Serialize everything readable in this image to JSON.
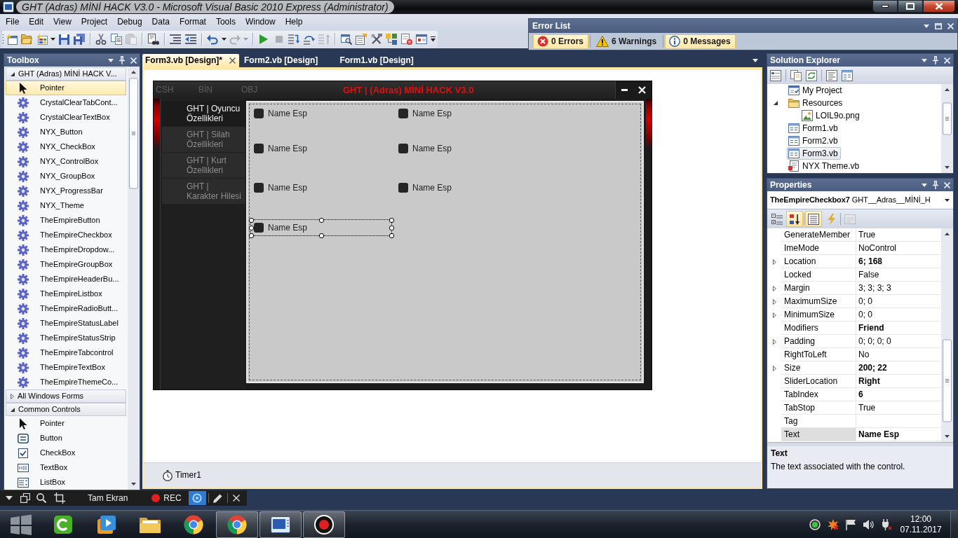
{
  "window": {
    "title": "GHT (Adras) MİNİ HACK V3.0 - Microsoft Visual Basic 2010 Express (Administrator)"
  },
  "menu": [
    "File",
    "Edit",
    "View",
    "Project",
    "Debug",
    "Data",
    "Format",
    "Tools",
    "Window",
    "Help"
  ],
  "toolbar": [
    {
      "buttons": [
        {
          "kind": "new-project",
          "disabled": false
        },
        {
          "kind": "open",
          "disabled": false
        },
        {
          "kind": "add-item",
          "disabled": false
        },
        {
          "kind": "dropdown",
          "disabled": false
        },
        {
          "kind": "save",
          "disabled": false
        },
        {
          "kind": "save-all",
          "disabled": false
        }
      ]
    },
    {
      "buttons": [
        {
          "kind": "cut",
          "disabled": false
        },
        {
          "kind": "copy",
          "disabled": false
        },
        {
          "kind": "paste",
          "disabled": true
        }
      ]
    },
    {
      "buttons": [
        {
          "kind": "find",
          "disabled": false
        }
      ]
    },
    {
      "buttons": [
        {
          "kind": "comment",
          "disabled": false
        },
        {
          "kind": "uncomment",
          "disabled": false
        }
      ]
    },
    {
      "buttons": [
        {
          "kind": "undo",
          "disabled": false
        },
        {
          "kind": "dropdown",
          "disabled": false
        },
        {
          "kind": "redo",
          "disabled": true
        },
        {
          "kind": "dropdown",
          "disabled": true
        }
      ]
    },
    {
      "buttons": [
        {
          "kind": "start",
          "disabled": false
        },
        {
          "kind": "stop",
          "disabled": true
        },
        {
          "kind": "step-into",
          "disabled": false
        },
        {
          "kind": "step-over",
          "disabled": false
        },
        {
          "kind": "step-out",
          "disabled": true
        }
      ]
    },
    {
      "buttons": [
        {
          "kind": "solution-explorer",
          "disabled": false
        },
        {
          "kind": "properties",
          "disabled": false
        },
        {
          "kind": "toolbox",
          "disabled": false
        },
        {
          "kind": "object-browser",
          "disabled": false
        },
        {
          "kind": "error-list",
          "disabled": false
        },
        {
          "kind": "immediate",
          "disabled": false
        },
        {
          "kind": "overflow",
          "disabled": false
        }
      ]
    }
  ],
  "error_list": {
    "title": "Error List",
    "filters": [
      {
        "kind": "error",
        "label": "0 Errors",
        "selected": true
      },
      {
        "kind": "warning",
        "label": "6 Warnings",
        "selected": false
      },
      {
        "kind": "info",
        "label": "0 Messages",
        "selected": true
      }
    ]
  },
  "toolbox": {
    "title": "Toolbox",
    "groups": [
      {
        "label": "GHT (Adras) MİNİ HACK V...",
        "expanded": true,
        "children": [
          {
            "label": "Pointer",
            "kind": "pointer",
            "selected": true
          },
          {
            "label": "CrystalClearTabCont...",
            "kind": "component",
            "selected": false
          },
          {
            "label": "CrystalClearTextBox",
            "kind": "component",
            "selected": false
          },
          {
            "label": "NYX_Button",
            "kind": "component",
            "selected": false
          },
          {
            "label": "NYX_CheckBox",
            "kind": "component",
            "selected": false
          },
          {
            "label": "NYX_ControlBox",
            "kind": "component",
            "selected": false
          },
          {
            "label": "NYX_GroupBox",
            "kind": "component",
            "selected": false
          },
          {
            "label": "NYX_ProgressBar",
            "kind": "component",
            "selected": false
          },
          {
            "label": "NYX_Theme",
            "kind": "component",
            "selected": false
          },
          {
            "label": "TheEmpireButton",
            "kind": "component",
            "selected": false
          },
          {
            "label": "TheEmpireCheckbox",
            "kind": "component",
            "selected": false
          },
          {
            "label": "TheEmpireDropdow...",
            "kind": "component",
            "selected": false
          },
          {
            "label": "TheEmpireGroupBox",
            "kind": "component",
            "selected": false
          },
          {
            "label": "TheEmpireHeaderBu...",
            "kind": "component",
            "selected": false
          },
          {
            "label": "TheEmpireListbox",
            "kind": "component",
            "selected": false
          },
          {
            "label": "TheEmpireRadioButt...",
            "kind": "component",
            "selected": false
          },
          {
            "label": "TheEmpireStatusLabel",
            "kind": "component",
            "selected": false
          },
          {
            "label": "TheEmpireStatusStrip",
            "kind": "component",
            "selected": false
          },
          {
            "label": "TheEmpireTabcontrol",
            "kind": "component",
            "selected": false
          },
          {
            "label": "TheEmpireTextBox",
            "kind": "component",
            "selected": false
          },
          {
            "label": "TheEmpireThemeCo...",
            "kind": "component",
            "selected": false
          }
        ]
      },
      {
        "label": "All Windows Forms",
        "expanded": false
      },
      {
        "label": "Common Controls",
        "expanded": true,
        "children": [
          {
            "label": "Pointer",
            "kind": "pointer",
            "selected": false
          },
          {
            "label": "Button",
            "kind": "button",
            "selected": false
          },
          {
            "label": "CheckBox",
            "kind": "checkbox",
            "selected": false
          },
          {
            "label": "TextBox",
            "kind": "textbox",
            "selected": false
          },
          {
            "label": "ListBox",
            "kind": "listbox",
            "selected": false
          }
        ]
      }
    ]
  },
  "document_tabs": [
    {
      "label": "Form3.vb [Design]*",
      "selected": true
    },
    {
      "label": "Form2.vb [Design]",
      "selected": false
    },
    {
      "label": "Form1.vb [Design]",
      "selected": false
    }
  ],
  "designer": {
    "form": {
      "menu": [
        "CSH",
        "BİN",
        "OBJ"
      ],
      "title": "GHT | (Adras) MİNİ HACK V3.0",
      "side_tabs": [
        {
          "label": "GHT | Oyuncu Özellikleri",
          "selected": true
        },
        {
          "label": "GHT | Silah Özellikleri",
          "selected": false
        },
        {
          "label": "GHT | Kurt Özellikleri",
          "selected": false
        },
        {
          "label": "GHT | Karakter Hilesi",
          "selected": false
        }
      ],
      "checkboxes": [
        {
          "label": "Name Esp",
          "checked": false,
          "selected": false
        },
        {
          "label": "Name Esp",
          "checked": false,
          "selected": false
        },
        {
          "label": "Name Esp",
          "checked": false,
          "selected": false
        },
        {
          "label": "Name Esp",
          "checked": false,
          "selected": false
        },
        {
          "label": "Name Esp",
          "checked": false,
          "selected": false
        },
        {
          "label": "Name Esp",
          "checked": false,
          "selected": false
        },
        {
          "label": "Name Esp",
          "checked": false,
          "selected": true
        }
      ]
    },
    "component_tray": [
      {
        "label": "Timer1"
      }
    ]
  },
  "solution_explorer": {
    "title": "Solution Explorer",
    "items": [
      {
        "label": "My Project",
        "kind": "project",
        "selected": false
      },
      {
        "label": "Resources",
        "kind": "folder",
        "selected": false,
        "expanded": true,
        "children": [
          {
            "label": "LOIL9o.png",
            "kind": "image",
            "selected": false
          }
        ]
      },
      {
        "label": "Form1.vb",
        "kind": "form",
        "selected": false
      },
      {
        "label": "Form2.vb",
        "kind": "form",
        "selected": false
      },
      {
        "label": "Form3.vb",
        "kind": "form",
        "selected": true
      },
      {
        "label": "NYX Theme.vb",
        "kind": "code",
        "selected": false
      }
    ]
  },
  "properties": {
    "title": "Properties",
    "object": {
      "label": "**TheEmpireCheckbox7** GHT__Adras__MİNİ_H"
    },
    "toolbar": [
      {
        "kind": "categorized",
        "selected": false,
        "disabled": false
      },
      {
        "kind": "alphabetical",
        "selected": true,
        "disabled": false
      },
      {
        "kind": "properties",
        "selected": true,
        "disabled": false
      },
      {
        "kind": "events",
        "selected": false,
        "disabled": false
      },
      {
        "kind": "property-pages",
        "selected": false,
        "disabled": true
      }
    ],
    "rows": [
      {
        "name": "GenerateMember",
        "value": "True",
        "modified": false,
        "expandable": false,
        "selected": false
      },
      {
        "name": "ImeMode",
        "value": "NoControl",
        "modified": false,
        "expandable": false,
        "selected": false
      },
      {
        "name": "Location",
        "value": "6; 168",
        "modified": true,
        "expandable": true,
        "selected": false
      },
      {
        "name": "Locked",
        "value": "False",
        "modified": false,
        "expandable": false,
        "selected": false
      },
      {
        "name": "Margin",
        "value": "3; 3; 3; 3",
        "modified": false,
        "expandable": true,
        "selected": false
      },
      {
        "name": "MaximumSize",
        "value": "0; 0",
        "modified": false,
        "expandable": true,
        "selected": false
      },
      {
        "name": "MinimumSize",
        "value": "0; 0",
        "modified": false,
        "expandable": true,
        "selected": false
      },
      {
        "name": "Modifiers",
        "value": "Friend",
        "modified": true,
        "expandable": false,
        "selected": false
      },
      {
        "name": "Padding",
        "value": "0; 0; 0; 0",
        "modified": false,
        "expandable": true,
        "selected": false
      },
      {
        "name": "RightToLeft",
        "value": "No",
        "modified": false,
        "expandable": false,
        "selected": false
      },
      {
        "name": "Size",
        "value": "200; 22",
        "modified": true,
        "expandable": true,
        "selected": false
      },
      {
        "name": "SliderLocation",
        "value": "Right",
        "modified": true,
        "expandable": false,
        "selected": false
      },
      {
        "name": "TabIndex",
        "value": "6",
        "modified": true,
        "expandable": false,
        "selected": false
      },
      {
        "name": "TabStop",
        "value": "True",
        "modified": false,
        "expandable": false,
        "selected": false
      },
      {
        "name": "Tag",
        "expandable": false,
        "selected": false
      },
      {
        "name": "Text",
        "value": "Name Esp",
        "modified": true,
        "expandable": false,
        "selected": true
      }
    ],
    "description": {
      "title": "Text",
      "text": "The text associated with the control."
    }
  },
  "recorder_bar": {
    "items": [
      {
        "kind": "menu",
        "selected": false
      },
      {
        "kind": "windows",
        "selected": false
      },
      {
        "kind": "zoom",
        "selected": false
      },
      {
        "kind": "region",
        "selected": false
      },
      {
        "kind": "label",
        "label": "Tam Ekran",
        "selected": false
      },
      {
        "kind": "record",
        "label": "REC",
        "selected": false
      },
      {
        "kind": "camera",
        "selected": true
      },
      {
        "kind": "pen",
        "selected": false
      },
      {
        "kind": "close",
        "selected": false
      }
    ]
  },
  "taskbar": {
    "apps": [
      {
        "kind": "recorder",
        "running": false
      },
      {
        "kind": "player",
        "running": false
      },
      {
        "kind": "folder",
        "running": false
      },
      {
        "kind": "browser",
        "running": false
      },
      {
        "kind": "browser",
        "running": true
      },
      {
        "kind": "ide",
        "running": true
      },
      {
        "kind": "record",
        "running": true
      }
    ],
    "clock": {
      "time": "12:00",
      "date": "07.11.2017"
    }
  }
}
